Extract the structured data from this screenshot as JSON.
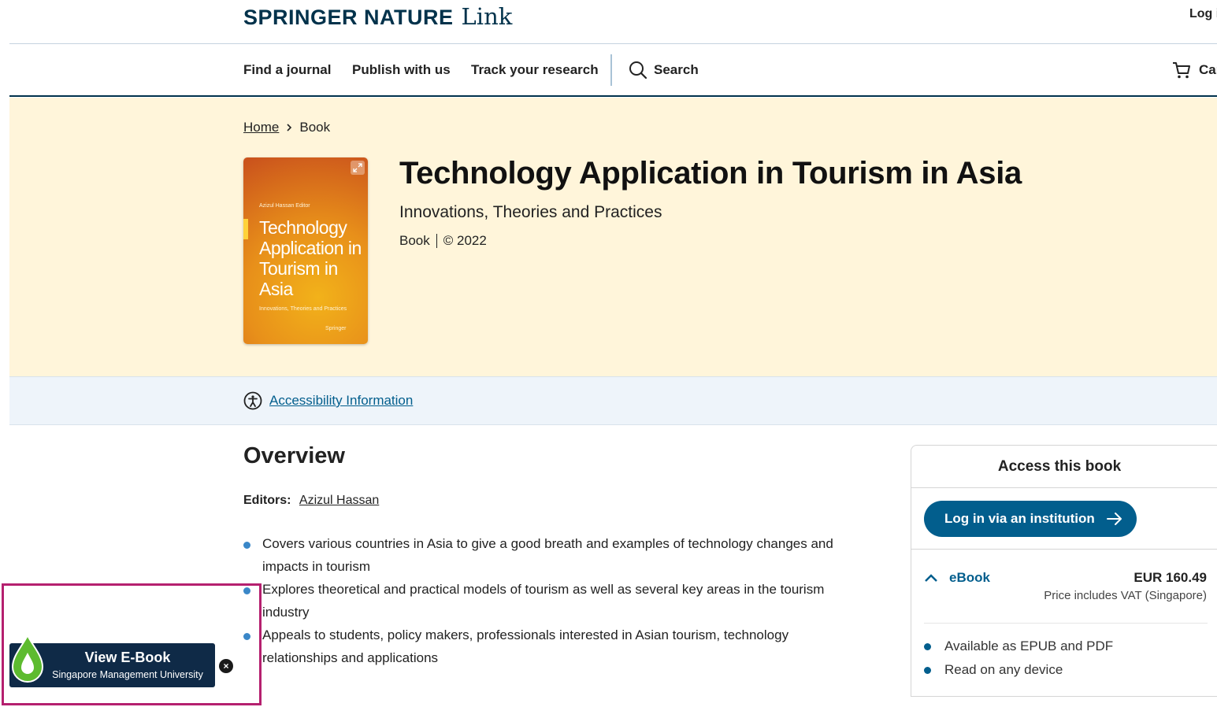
{
  "header": {
    "brand": "SPRINGER NATURE",
    "brand_suffix": "Link",
    "login": "Log i"
  },
  "nav": {
    "items": [
      "Find a journal",
      "Publish with us",
      "Track your research"
    ],
    "search_label": "Search",
    "cart_label": "Car"
  },
  "breadcrumb": {
    "home": "Home",
    "current": "Book"
  },
  "book": {
    "title": "Technology Application in Tourism in Asia",
    "subtitle": "Innovations, Theories and Practices",
    "type": "Book",
    "copyright": "© 2022",
    "cover": {
      "editor_line": "Azizul Hassan  Editor",
      "title": "Technology Application in Tourism in Asia",
      "subtitle": "Innovations, Theories and Practices",
      "publisher": "Springer"
    }
  },
  "accessibility": {
    "link": "Accessibility Information"
  },
  "overview": {
    "heading": "Overview",
    "editors_label": "Editors:",
    "editor_name": "Azizul Hassan",
    "bullets": [
      "Covers various countries in Asia to give a good breath and examples of technology changes and impacts in tourism",
      "Explores theoretical and practical models of tourism as well as several key areas in the tourism industry",
      "Appeals to students, policy makers, professionals interested in Asian tourism, technology relationships and applications"
    ]
  },
  "access_panel": {
    "heading": "Access this book",
    "login_button": "Log in via an institution",
    "format": "eBook",
    "price": "EUR 160.49",
    "vat_note": "Price includes VAT (Singapore)",
    "features": [
      "Available as EPUB and PDF",
      "Read on any device"
    ]
  },
  "widget": {
    "title": "View E-Book",
    "subtitle": "Singapore Management University",
    "accent_color": "#b5206f",
    "background_color": "#0f2a47"
  },
  "colors": {
    "brand_navy": "#01324b",
    "link_blue": "#025e8d",
    "hero_bg": "#fff5da"
  }
}
